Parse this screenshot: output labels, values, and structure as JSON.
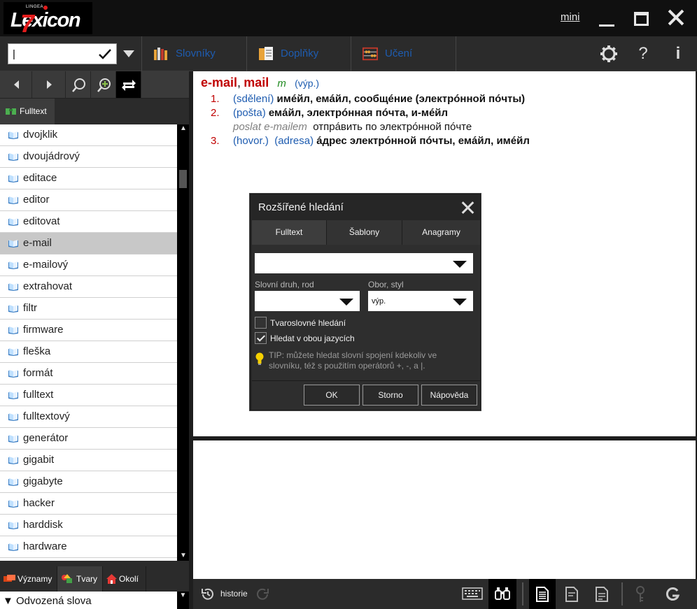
{
  "app": {
    "logo_brand": "LINGEA",
    "logo_word": "Lexicon",
    "logo_num": "7",
    "mini_label": "mini"
  },
  "toolbar": {
    "search_value": "|",
    "tabs": [
      {
        "label": "Slovníky",
        "icon": "books-icon"
      },
      {
        "label": "Doplňky",
        "icon": "addons-icon"
      },
      {
        "label": "Učení",
        "icon": "abacus-icon"
      }
    ],
    "help_glyph": "?",
    "info_glyph": "i"
  },
  "sidebar": {
    "fulltext_tab": "Fulltext",
    "words": [
      "dvojklik",
      "dvoujádrový",
      "editace",
      "editor",
      "editovat",
      "e-mail",
      "e-mailový",
      "extrahovat",
      "filtr",
      "firmware",
      "fleška",
      "formát",
      "fulltext",
      "fulltextový",
      "generátor",
      "gigabit",
      "gigabyte",
      "hacker",
      "harddisk",
      "hardware"
    ],
    "selected_word": "e-mail",
    "bottom_tabs": [
      "Významy",
      "Tvary",
      "Okolí"
    ],
    "derived_label": "Odvozená slova"
  },
  "entry": {
    "headword1": "e-mail",
    "comma": ",",
    "headword2": "mail",
    "gram": "m",
    "style": "(výp.)",
    "senses": [
      {
        "num": "1.",
        "label": "(sdělení)",
        "label2": "",
        "ru": "имéйл, емáйл, сообщéние (электрóнной пóчты)"
      },
      {
        "num": "2.",
        "label": "(pošta)",
        "label2": "",
        "ru": "емáйл, электрóнная пóчта, и-мéйл"
      },
      {
        "num": "3.",
        "label": "(hovor.)",
        "label2": "(adresa)",
        "ru": "áдрес электрóнной пóчты, емáйл, имéйл"
      }
    ],
    "example_cz": "poslat e-mailem",
    "example_ru": "отпрáвить по электрóнной пóчте"
  },
  "dialog": {
    "title": "Rozšířené hledání",
    "tabs": [
      "Fulltext",
      "Šablony",
      "Anagramy"
    ],
    "field1_label": "Slovní druh, rod",
    "field2_label": "Obor, styl",
    "field2_value": "výp.",
    "check1_label": "Tvaroslovné hledání",
    "check2_label": "Hledat v obou jazycích",
    "tip": "TIP: můžete hledat slovní spojení kdekoliv ve slovníku, též s použitím operátorů +, -,  a |.",
    "ok": "OK",
    "cancel": "Storno",
    "help": "Nápověda"
  },
  "statusbar": {
    "history_label": "historie"
  },
  "colors": {
    "headword": "#c00000",
    "label_blue": "#1e5cb0",
    "gram_green": "#1f8a1f",
    "logo_red": "#e21b1b"
  }
}
